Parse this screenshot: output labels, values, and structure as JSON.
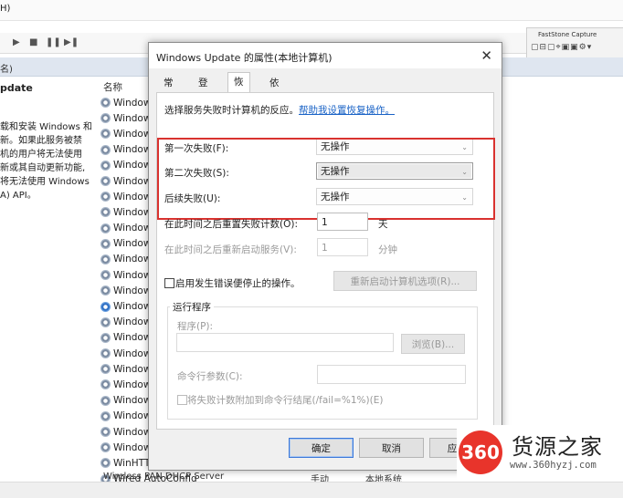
{
  "background": {
    "title_fragment": "H)",
    "toolbar_glyphs": [
      "▶",
      "■",
      "❚❚",
      "▶❚"
    ],
    "pane_header": "名)",
    "left_pane": {
      "title": "pdate",
      "description": "载和安装 Windows 和\n新。如果此服务被禁\n机的用户将无法使用\n新或其自动更新功能,\n将无法使用 Windows\nA) API。"
    },
    "column_name": "名称",
    "services": [
      "Window",
      "Window",
      "Window",
      "Window",
      "Window",
      "Window",
      "Window",
      "Window",
      "Window",
      "Window",
      "Window",
      "Window",
      "Window",
      "Window",
      "Window",
      "Window",
      "Window",
      "Window",
      "Window",
      "Window",
      "Window",
      "Window",
      "Window",
      "WinHTT",
      "Wired AutoConfig"
    ],
    "bottom_row": {
      "name": "Wireless PAN DHCP Server",
      "startup": "手动",
      "logon": "本地系统"
    },
    "faststone": {
      "title": "FastStone Capture",
      "icons": "▢⊟▢⌖▣▣⚙▾"
    }
  },
  "dialog": {
    "title": "Windows Update 的属性(本地计算机)",
    "close_glyph": "✕",
    "tabs": [
      "常规",
      "登录",
      "恢复",
      "依存关系"
    ],
    "active_tab": 2,
    "intro": "选择服务失败时计算机的反应。",
    "help_link": "帮助我设置恢复操作。",
    "first_failure": {
      "label": "第一次失败(F):",
      "value": "无操作"
    },
    "second_failure": {
      "label": "第二次失败(S):",
      "value": "无操作"
    },
    "subsequent_failure": {
      "label": "后续失败(U):",
      "value": "无操作"
    },
    "reset_count": {
      "label": "在此时间之后重置失败计数(O):",
      "value": "1",
      "unit": "天"
    },
    "restart_service": {
      "label": "在此时间之后重新启动服务(V):",
      "value": "1",
      "unit": "分钟"
    },
    "enable_actions_label": "启用发生错误便停止的操作。",
    "restart_options_button": "重新启动计算机选项(R)...",
    "run_program": {
      "group_label": "运行程序",
      "program_label": "程序(P):",
      "browse_button": "浏览(B)...",
      "params_label": "命令行参数(C):",
      "append_label": "将失败计数附加到命令行结尾(/fail=%1%)(E)"
    },
    "buttons": {
      "ok": "确定",
      "cancel": "取消",
      "apply": "应"
    }
  },
  "watermark": {
    "logo": "360",
    "name": "货源之家",
    "url": "www.360hyzj.com"
  },
  "colors": {
    "highlight_box": "#d9322f",
    "link": "#1a63c6",
    "logo_red": "#e8342b"
  }
}
